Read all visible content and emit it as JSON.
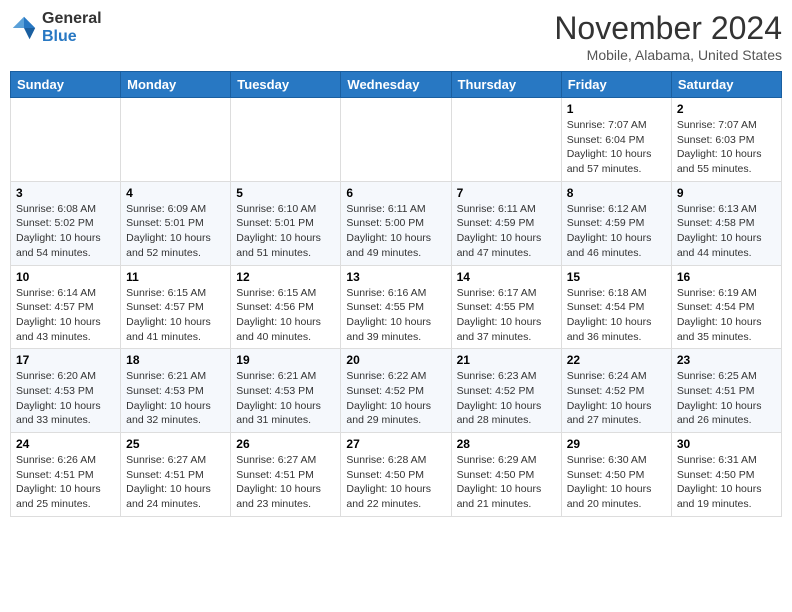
{
  "header": {
    "logo_line1": "General",
    "logo_line2": "Blue",
    "month_title": "November 2024",
    "location": "Mobile, Alabama, United States"
  },
  "days_of_week": [
    "Sunday",
    "Monday",
    "Tuesday",
    "Wednesday",
    "Thursday",
    "Friday",
    "Saturday"
  ],
  "weeks": [
    [
      {
        "day": "",
        "info": ""
      },
      {
        "day": "",
        "info": ""
      },
      {
        "day": "",
        "info": ""
      },
      {
        "day": "",
        "info": ""
      },
      {
        "day": "",
        "info": ""
      },
      {
        "day": "1",
        "info": "Sunrise: 7:07 AM\nSunset: 6:04 PM\nDaylight: 10 hours\nand 57 minutes."
      },
      {
        "day": "2",
        "info": "Sunrise: 7:07 AM\nSunset: 6:03 PM\nDaylight: 10 hours\nand 55 minutes."
      }
    ],
    [
      {
        "day": "3",
        "info": "Sunrise: 6:08 AM\nSunset: 5:02 PM\nDaylight: 10 hours\nand 54 minutes."
      },
      {
        "day": "4",
        "info": "Sunrise: 6:09 AM\nSunset: 5:01 PM\nDaylight: 10 hours\nand 52 minutes."
      },
      {
        "day": "5",
        "info": "Sunrise: 6:10 AM\nSunset: 5:01 PM\nDaylight: 10 hours\nand 51 minutes."
      },
      {
        "day": "6",
        "info": "Sunrise: 6:11 AM\nSunset: 5:00 PM\nDaylight: 10 hours\nand 49 minutes."
      },
      {
        "day": "7",
        "info": "Sunrise: 6:11 AM\nSunset: 4:59 PM\nDaylight: 10 hours\nand 47 minutes."
      },
      {
        "day": "8",
        "info": "Sunrise: 6:12 AM\nSunset: 4:59 PM\nDaylight: 10 hours\nand 46 minutes."
      },
      {
        "day": "9",
        "info": "Sunrise: 6:13 AM\nSunset: 4:58 PM\nDaylight: 10 hours\nand 44 minutes."
      }
    ],
    [
      {
        "day": "10",
        "info": "Sunrise: 6:14 AM\nSunset: 4:57 PM\nDaylight: 10 hours\nand 43 minutes."
      },
      {
        "day": "11",
        "info": "Sunrise: 6:15 AM\nSunset: 4:57 PM\nDaylight: 10 hours\nand 41 minutes."
      },
      {
        "day": "12",
        "info": "Sunrise: 6:15 AM\nSunset: 4:56 PM\nDaylight: 10 hours\nand 40 minutes."
      },
      {
        "day": "13",
        "info": "Sunrise: 6:16 AM\nSunset: 4:55 PM\nDaylight: 10 hours\nand 39 minutes."
      },
      {
        "day": "14",
        "info": "Sunrise: 6:17 AM\nSunset: 4:55 PM\nDaylight: 10 hours\nand 37 minutes."
      },
      {
        "day": "15",
        "info": "Sunrise: 6:18 AM\nSunset: 4:54 PM\nDaylight: 10 hours\nand 36 minutes."
      },
      {
        "day": "16",
        "info": "Sunrise: 6:19 AM\nSunset: 4:54 PM\nDaylight: 10 hours\nand 35 minutes."
      }
    ],
    [
      {
        "day": "17",
        "info": "Sunrise: 6:20 AM\nSunset: 4:53 PM\nDaylight: 10 hours\nand 33 minutes."
      },
      {
        "day": "18",
        "info": "Sunrise: 6:21 AM\nSunset: 4:53 PM\nDaylight: 10 hours\nand 32 minutes."
      },
      {
        "day": "19",
        "info": "Sunrise: 6:21 AM\nSunset: 4:53 PM\nDaylight: 10 hours\nand 31 minutes."
      },
      {
        "day": "20",
        "info": "Sunrise: 6:22 AM\nSunset: 4:52 PM\nDaylight: 10 hours\nand 29 minutes."
      },
      {
        "day": "21",
        "info": "Sunrise: 6:23 AM\nSunset: 4:52 PM\nDaylight: 10 hours\nand 28 minutes."
      },
      {
        "day": "22",
        "info": "Sunrise: 6:24 AM\nSunset: 4:52 PM\nDaylight: 10 hours\nand 27 minutes."
      },
      {
        "day": "23",
        "info": "Sunrise: 6:25 AM\nSunset: 4:51 PM\nDaylight: 10 hours\nand 26 minutes."
      }
    ],
    [
      {
        "day": "24",
        "info": "Sunrise: 6:26 AM\nSunset: 4:51 PM\nDaylight: 10 hours\nand 25 minutes."
      },
      {
        "day": "25",
        "info": "Sunrise: 6:27 AM\nSunset: 4:51 PM\nDaylight: 10 hours\nand 24 minutes."
      },
      {
        "day": "26",
        "info": "Sunrise: 6:27 AM\nSunset: 4:51 PM\nDaylight: 10 hours\nand 23 minutes."
      },
      {
        "day": "27",
        "info": "Sunrise: 6:28 AM\nSunset: 4:50 PM\nDaylight: 10 hours\nand 22 minutes."
      },
      {
        "day": "28",
        "info": "Sunrise: 6:29 AM\nSunset: 4:50 PM\nDaylight: 10 hours\nand 21 minutes."
      },
      {
        "day": "29",
        "info": "Sunrise: 6:30 AM\nSunset: 4:50 PM\nDaylight: 10 hours\nand 20 minutes."
      },
      {
        "day": "30",
        "info": "Sunrise: 6:31 AM\nSunset: 4:50 PM\nDaylight: 10 hours\nand 19 minutes."
      }
    ]
  ]
}
